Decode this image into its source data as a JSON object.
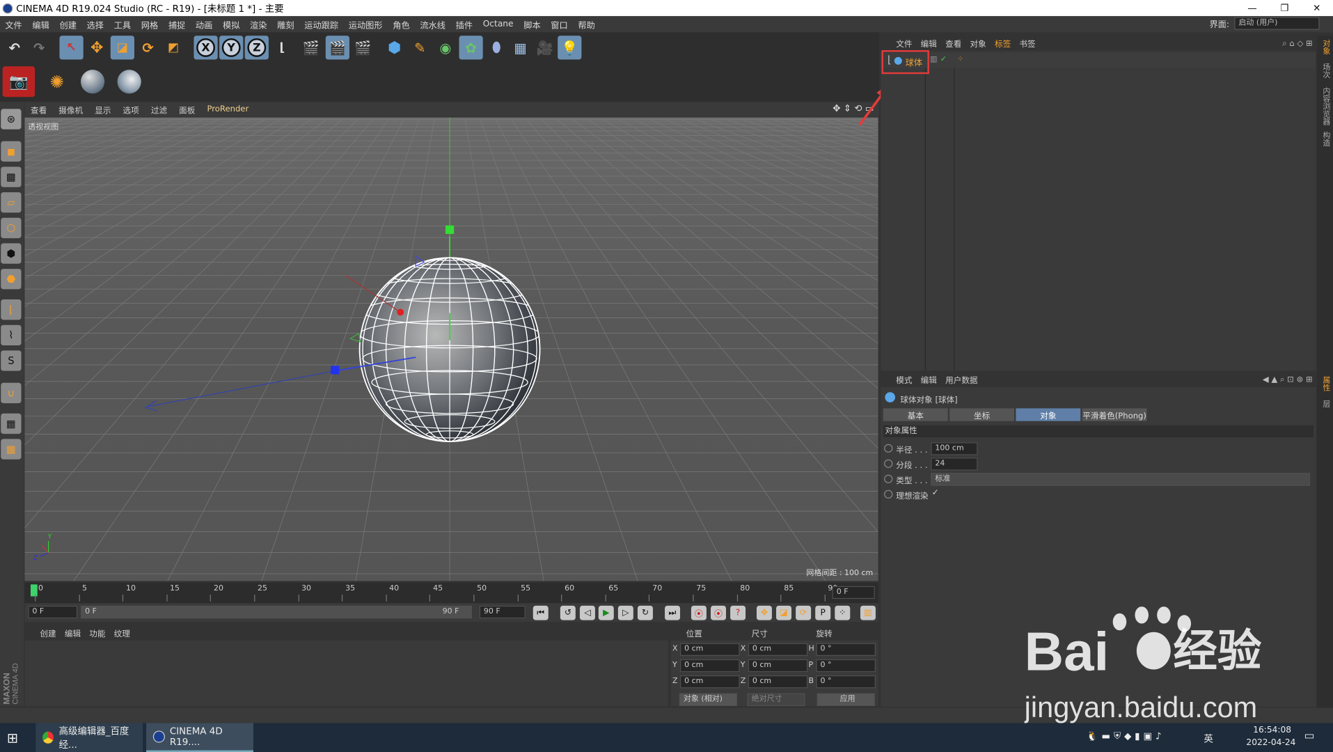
{
  "window": {
    "title": "CINEMA 4D R19.024 Studio (RC - R19) - [未标题 1 *] - 主要",
    "min": "—",
    "max": "❐",
    "close": "✕"
  },
  "menu": {
    "items": [
      "文件",
      "编辑",
      "创建",
      "选择",
      "工具",
      "网格",
      "捕捉",
      "动画",
      "模拟",
      "渲染",
      "雕刻",
      "运动跟踪",
      "运动图形",
      "角色",
      "流水线",
      "插件",
      "Octane",
      "脚本",
      "窗口",
      "帮助"
    ],
    "interface_label": "界面:",
    "interface_value": "启动 (用户)"
  },
  "viewport": {
    "menu": [
      "查看",
      "摄像机",
      "显示",
      "选项",
      "过滤",
      "面板",
      "ProRender"
    ],
    "label": "透视视图",
    "grid_note": "网格间距 : 100 cm"
  },
  "timeline": {
    "ticks": [
      "0",
      "5",
      "10",
      "15",
      "20",
      "25",
      "30",
      "35",
      "40",
      "45",
      "50",
      "55",
      "60",
      "65",
      "70",
      "75",
      "80",
      "85",
      "90"
    ],
    "end_field": "0 F",
    "current": "0 F",
    "range_start": "0 F",
    "range_end": "90 F",
    "max": "90 F"
  },
  "material_manager": {
    "menu": [
      "创建",
      "编辑",
      "功能",
      "纹理"
    ]
  },
  "coordinates": {
    "headers": [
      "位置",
      "尺寸",
      "旋转"
    ],
    "rows": [
      {
        "a1": "X",
        "v1": "0 cm",
        "a2": "X",
        "v2": "0 cm",
        "a3": "H",
        "v3": "0 °"
      },
      {
        "a1": "Y",
        "v1": "0 cm",
        "a2": "Y",
        "v2": "0 cm",
        "a3": "P",
        "v3": "0 °"
      },
      {
        "a1": "Z",
        "v1": "0 cm",
        "a2": "Z",
        "v2": "0 cm",
        "a3": "B",
        "v3": "0 °"
      }
    ],
    "mode": "对象 (相对)",
    "size_mode": "绝对尺寸",
    "apply": "应用"
  },
  "object_manager": {
    "menu": [
      "文件",
      "编辑",
      "查看",
      "对象",
      "标签",
      "书签"
    ],
    "objects": [
      {
        "name": "球体"
      }
    ]
  },
  "attribute_manager": {
    "menu": [
      "模式",
      "编辑",
      "用户数据"
    ],
    "object_title": "球体对象 [球体]",
    "tabs": [
      "基本",
      "坐标",
      "对象",
      "平滑着色(Phong)"
    ],
    "section": "对象属性",
    "props": [
      {
        "label": "半径 . . .",
        "value": "100 cm"
      },
      {
        "label": "分段 . . .",
        "value": "24"
      },
      {
        "label": "类型 . . .",
        "value": "标准"
      },
      {
        "label": "理想渲染",
        "value": "✓"
      }
    ]
  },
  "right_strip": [
    "对象",
    "场次",
    "内容浏览器",
    "构造"
  ],
  "right_strip2": [
    "属性",
    "层"
  ],
  "brand": {
    "maxon": "MAXON",
    "c4d": "CINEMA 4D"
  },
  "taskbar": {
    "tasks": [
      "高级编辑器_百度经...",
      "CINEMA 4D R19...."
    ],
    "ime": "英",
    "time": "16:54:08",
    "date": "2022-04-24"
  },
  "watermark": {
    "text1": "Bai",
    "text2": "经验",
    "url": "jingyan.baidu.com"
  },
  "colors": {
    "accent": "#f0a030",
    "active_tab": "#5f7fa8",
    "highlight": "#e23b3b"
  }
}
